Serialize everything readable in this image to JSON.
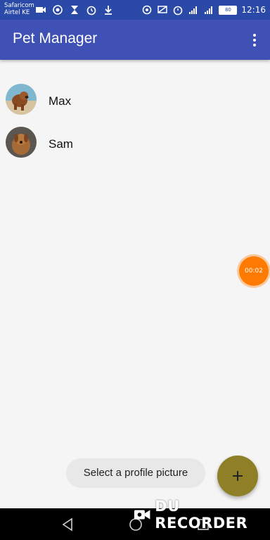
{
  "status_bar": {
    "carrier_primary": "Safaricom",
    "carrier_secondary": "Airtel KE",
    "battery": "80",
    "time": "12:16",
    "icons_left": [
      "video-camera-icon",
      "eye-icon",
      "hourglass-icon",
      "alarm-clock-icon",
      "download-icon"
    ],
    "icons_right": [
      "vpn-key-icon",
      "cast-icon",
      "alarm-icon",
      "signal-icon",
      "signal-icon"
    ]
  },
  "app_bar": {
    "title": "Pet Manager",
    "menu_icon": "more-vert-icon"
  },
  "pets": [
    {
      "name": "Max",
      "avatar": "dog-photo-beach"
    },
    {
      "name": "Sam",
      "avatar": "dog-photo-brown"
    }
  ],
  "recorder_timer": "00:02",
  "toast": "Select a profile picture",
  "fab": {
    "icon": "plus-icon",
    "color": "#8f8027"
  },
  "watermark": "DU RECORDER",
  "navigation": [
    "back-icon",
    "home-icon",
    "recents-icon"
  ],
  "colors": {
    "status_bar": "#2b4aa8",
    "app_bar": "#3f51b5",
    "timer": "#ff7a00"
  }
}
